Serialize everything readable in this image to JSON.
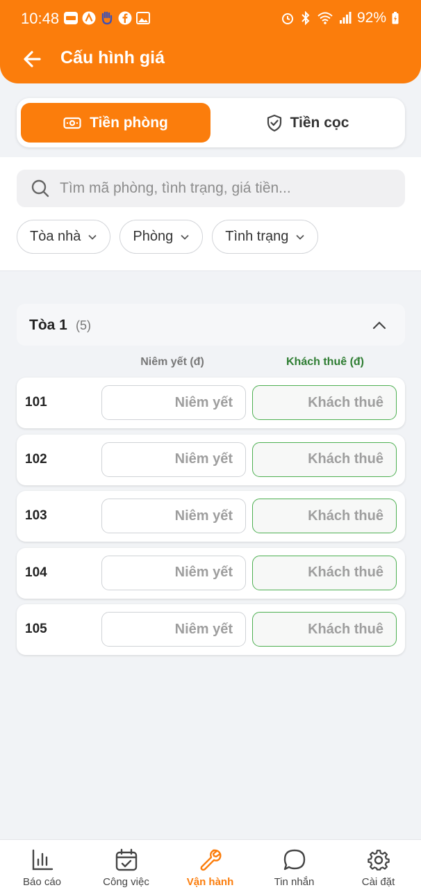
{
  "status_bar": {
    "time": "10:48",
    "battery": "92%"
  },
  "header": {
    "title": "Cấu hình giá"
  },
  "tabs": [
    {
      "label": "Tiền phòng",
      "icon": "money-icon",
      "active": true
    },
    {
      "label": "Tiền cọc",
      "icon": "shield-check-icon",
      "active": false
    }
  ],
  "search": {
    "placeholder": "Tìm mã phòng, tình trạng, giá tiền..."
  },
  "filters": [
    {
      "label": "Tòa nhà"
    },
    {
      "label": "Phòng"
    },
    {
      "label": "Tình trạng"
    }
  ],
  "group": {
    "name": "Tòa 1",
    "count": "(5)",
    "col_listed": "Niêm yết (đ)",
    "col_tenant": "Khách thuê (đ)",
    "rooms": [
      {
        "number": "101",
        "listed_placeholder": "Niêm yết",
        "tenant_placeholder": "Khách thuê"
      },
      {
        "number": "102",
        "listed_placeholder": "Niêm yết",
        "tenant_placeholder": "Khách thuê"
      },
      {
        "number": "103",
        "listed_placeholder": "Niêm yết",
        "tenant_placeholder": "Khách thuê"
      },
      {
        "number": "104",
        "listed_placeholder": "Niêm yết",
        "tenant_placeholder": "Khách thuê"
      },
      {
        "number": "105",
        "listed_placeholder": "Niêm yết",
        "tenant_placeholder": "Khách thuê"
      }
    ]
  },
  "bottom_nav": [
    {
      "label": "Báo cáo",
      "icon": "bar-chart-icon",
      "active": false
    },
    {
      "label": "Công việc",
      "icon": "calendar-check-icon",
      "active": false
    },
    {
      "label": "Vận hành",
      "icon": "wrench-icon",
      "active": true
    },
    {
      "label": "Tin nhắn",
      "icon": "chat-bubble-icon",
      "active": false
    },
    {
      "label": "Cài đặt",
      "icon": "gear-icon",
      "active": false
    }
  ],
  "colors": {
    "accent": "#fb7d0c",
    "tenant_border": "#4caf50",
    "tenant_text": "#2e7d32"
  }
}
